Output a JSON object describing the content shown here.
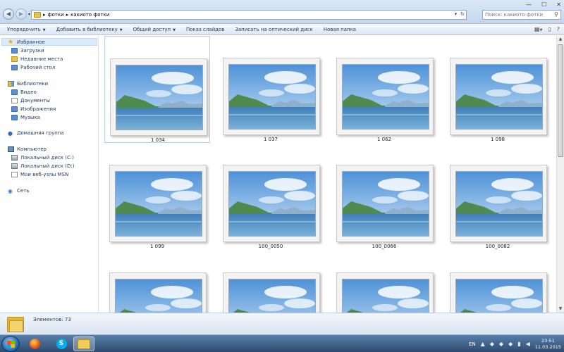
{
  "window": {
    "minimize": "—",
    "maximize": "☐",
    "close": "✕"
  },
  "address": {
    "path": [
      "фотки",
      "какиото фотки"
    ],
    "separator": "▸",
    "refresh": "↻",
    "dropdown": "▾"
  },
  "search": {
    "placeholder": "Поиск: какиото фотки",
    "icon": "search-icon"
  },
  "toolbar": {
    "organize": "Упорядочить",
    "add_to_library": "Добавить в библиотеку",
    "share": "Общий доступ",
    "slideshow": "Показ слайдов",
    "burn": "Записать на оптический диск",
    "new_folder": "Новая папка"
  },
  "sidebar": {
    "favorites": {
      "label": "Избранное",
      "items": [
        "Загрузки",
        "Недавние места",
        "Рабочий стол"
      ]
    },
    "libraries": {
      "label": "Библиотеки",
      "items": [
        "Видео",
        "Документы",
        "Изображения",
        "Музыка"
      ]
    },
    "homegroup": "Домашняя группа",
    "computer": {
      "label": "Компьютер",
      "items": [
        "Локальный диск (C:)",
        "Локальный диск (D:)",
        "Мои веб-узлы MSN"
      ]
    },
    "network": "Сеть"
  },
  "files": [
    {
      "name": "1 034"
    },
    {
      "name": "1 037"
    },
    {
      "name": "1 062"
    },
    {
      "name": "1 098"
    },
    {
      "name": "1 099"
    },
    {
      "name": "100_0050"
    },
    {
      "name": "100_0066"
    },
    {
      "name": "100_0082"
    },
    {
      "name": ""
    },
    {
      "name": ""
    },
    {
      "name": ""
    },
    {
      "name": ""
    }
  ],
  "status": {
    "count_text": "Элементов: 73"
  },
  "taskbar": {
    "language": "EN",
    "time": "23:51",
    "date": "11.03.2015"
  },
  "colors": {
    "accent": "#1e395b",
    "selection": "#dceafc",
    "taskbar": "#2d4b70"
  }
}
